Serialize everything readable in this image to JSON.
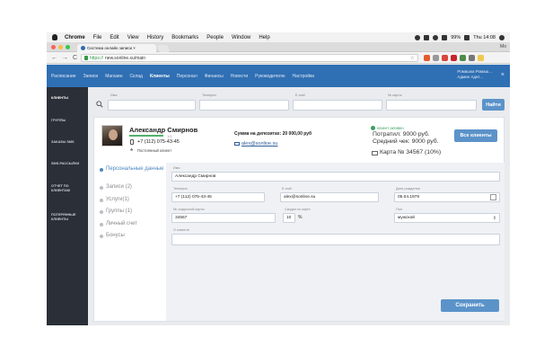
{
  "menubar": {
    "app": "Chrome",
    "items": [
      "File",
      "Edit",
      "View",
      "History",
      "Bookmarks",
      "People",
      "Window",
      "Help"
    ],
    "battery": "99%",
    "clock": "Thu 14:08"
  },
  "browser": {
    "tab_title": "Система онлайн записи ×",
    "tab_user": "Mo",
    "url_scheme": "https://",
    "url_host": "new.sonline.su/main",
    "nav_back": "←",
    "nav_forward": "→",
    "nav_reload": "C",
    "star": "☆"
  },
  "appnav": {
    "items": [
      "Расписание",
      "Записи",
      "Магазин",
      "Склад",
      "Клиенты",
      "Персонал",
      "Финансы",
      "Новости",
      "Руководителю",
      "Настройки"
    ],
    "active_index": 4,
    "user_line1": "Ромашка Ромаш...",
    "user_line2": "Админ Адит...",
    "close": "×"
  },
  "sidebar": {
    "items": [
      "КЛИЕНТЫ",
      "ГРУППЫ",
      "ЗАКАЗЫ SMS",
      "SMS-РАССЫЛКИ",
      "ОТЧЕТ ПО КЛИЕНТАМ",
      "ПОТЕРЯННЫЕ КЛИЕНТЫ"
    ],
    "active_index": 0
  },
  "search": {
    "label_name": "Имя",
    "label_phone": "Телефон",
    "label_email": "E-mail",
    "label_card": "№ карты",
    "button": "Найти"
  },
  "client": {
    "name": "Александр Смирнов",
    "progress_text": "1/1",
    "progress_fraction": 1.0,
    "phone": "+7 (112) 075-43-45",
    "loyalty": "Постоянный клиент",
    "deposit": "Сумма на депозитах: 20 000,00 руб",
    "email": "alex@sonline.su",
    "status": "клиент активен",
    "spent": "Потратил: 9000 руб.",
    "avg_check": "Средний чек: 9000 руб.",
    "card": "Карта № 34567 (10%)",
    "all_clients_button": "Все клиенты"
  },
  "menu": {
    "items": [
      "Персональные данные",
      "Записи (2)",
      "Услуги(1)",
      "Группы (1)",
      "Личный счет",
      "Бонусы"
    ],
    "active_index": 0
  },
  "form": {
    "name_label": "Имя",
    "name_value": "Александр Смирнов",
    "phone_label": "Телефон",
    "phone_value": "+7 (112) 075-43-45",
    "email_label": "E-mail",
    "email_value": "alex@sonline.su",
    "birth_label": "Дата рождения",
    "birth_value": "05.04.1978",
    "card_label": "№ скидочной карты",
    "card_value": "34567",
    "discount_label": "Скидка по карте",
    "discount_value": "10",
    "discount_unit": "%",
    "sex_label": "Пол",
    "sex_value": "мужской",
    "about_label": "О клиенте",
    "save_button": "Сохранить"
  },
  "colors": {
    "header": "#2f6fb3",
    "sidebar": "#2b2f37",
    "accent_button": "#5b93c9",
    "active_green": "#3aa05a"
  }
}
